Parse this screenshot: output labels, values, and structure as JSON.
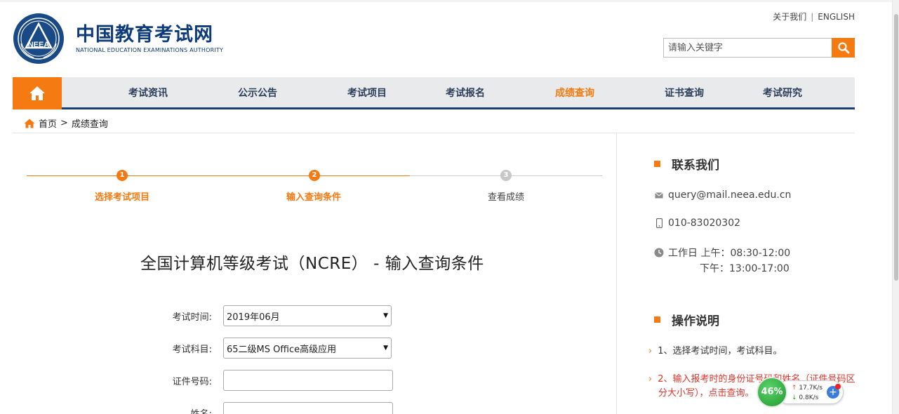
{
  "header": {
    "about_label": "关于我们",
    "separator": "|",
    "english_label": "ENGLISH",
    "logo_title": "中国教育考试网",
    "logo_subtitle": "NATIONAL EDUCATION EXAMINATIONS AUTHORITY",
    "logo_emblem_text": "NEEA",
    "search_placeholder": "请输入关键字"
  },
  "nav": {
    "items": [
      {
        "label": "考试资讯"
      },
      {
        "label": "公示公告"
      },
      {
        "label": "考试项目"
      },
      {
        "label": "考试报名"
      },
      {
        "label": "成绩查询"
      },
      {
        "label": "证书查询"
      },
      {
        "label": "考试研究"
      }
    ],
    "active_index": 4
  },
  "breadcrumb": {
    "home": "首页",
    "separator": ">",
    "current": "成绩查询"
  },
  "steps": [
    {
      "number": "1",
      "label": "选择考试项目",
      "state": "done"
    },
    {
      "number": "2",
      "label": "输入查询条件",
      "state": "current"
    },
    {
      "number": "3",
      "label": "查看成绩",
      "state": "todo"
    }
  ],
  "form": {
    "title": "全国计算机等级考试（NCRE） - 输入查询条件",
    "exam_time_label": "考试时间:",
    "exam_time_value": "2019年06月",
    "subject_label": "考试科目:",
    "subject_value": "65二级MS Office高级应用",
    "id_label": "证件号码:",
    "id_value": "",
    "name_label": "姓名:",
    "name_value": ""
  },
  "sidebar": {
    "contact_heading": "联系我们",
    "email": "query@mail.neea.edu.cn",
    "phone": "010-83020302",
    "hours_line1": "工作日 上午：08:30-12:00",
    "hours_line2": "下午：13:00-17:00",
    "ops_heading": "操作说明",
    "op1": "1、选择考试时间，考试科目。",
    "op2": "2、输入报考时的身份证号码和姓名（证件号码区分大小写），点击查询。"
  },
  "speed_widget": {
    "percent": "46%",
    "upload": "17.7K/s",
    "download": "0.8K/s"
  },
  "colors": {
    "accent": "#f57a12",
    "navy": "#1c3f72",
    "nav_bg": "#e9eaec"
  }
}
